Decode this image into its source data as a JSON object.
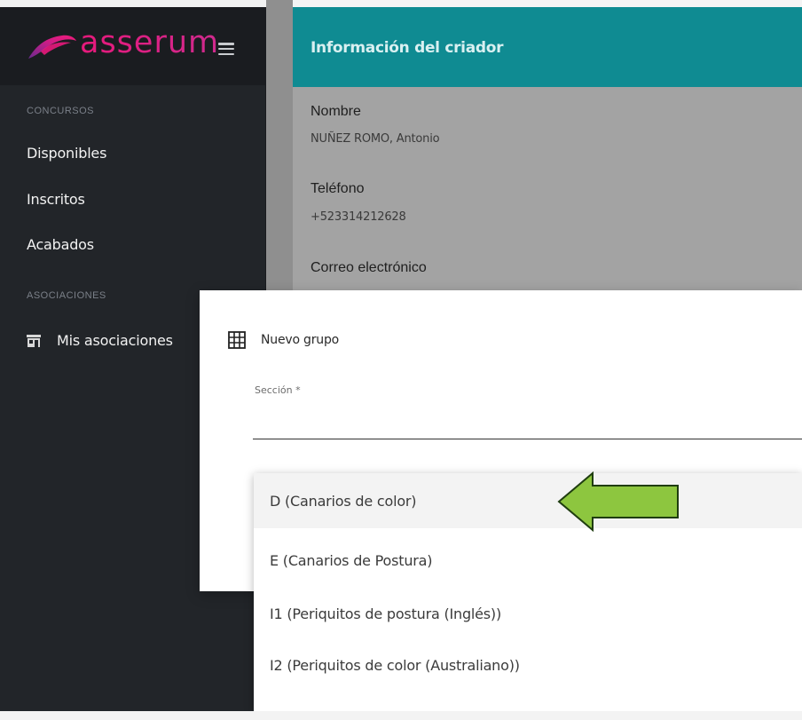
{
  "brand": {
    "name": "asserum",
    "accent": "#e6197b",
    "accent2": "#8a2a8e"
  },
  "sidebar": {
    "menu_icon": "hamburger-icon",
    "sections": {
      "concursos": {
        "title": "CONCURSOS",
        "items": [
          {
            "label": "Disponibles"
          },
          {
            "label": "Inscritos"
          },
          {
            "label": "Acabados"
          }
        ]
      },
      "asociaciones": {
        "title": "ASOCIACIONES",
        "items": [
          {
            "label": "Mis asociaciones",
            "icon": "store-icon"
          }
        ]
      }
    }
  },
  "card": {
    "title": "Información del criador",
    "header_color": "#0f8b92",
    "fields": [
      {
        "label": "Nombre",
        "value": "NUÑEZ ROMO, Antonio"
      },
      {
        "label": "Teléfono",
        "value": "+523314212628"
      },
      {
        "label": "Correo electrónico",
        "value": ""
      }
    ]
  },
  "modal": {
    "title": "Nuevo grupo",
    "icon": "grid-icon",
    "field": {
      "label": "Sección *",
      "value": ""
    }
  },
  "dropdown": {
    "options": [
      {
        "label": "D (Canarios de color)",
        "highlighted": true
      },
      {
        "label": "E (Canarios de Postura)",
        "highlighted": false
      },
      {
        "label": "I1 (Periquitos de postura (Inglés))",
        "highlighted": false
      },
      {
        "label": "I2 (Periquitos de color (Australiano))",
        "highlighted": false
      }
    ]
  },
  "annotation": {
    "icon": "arrow-left-icon",
    "color": "#8dc63f"
  }
}
